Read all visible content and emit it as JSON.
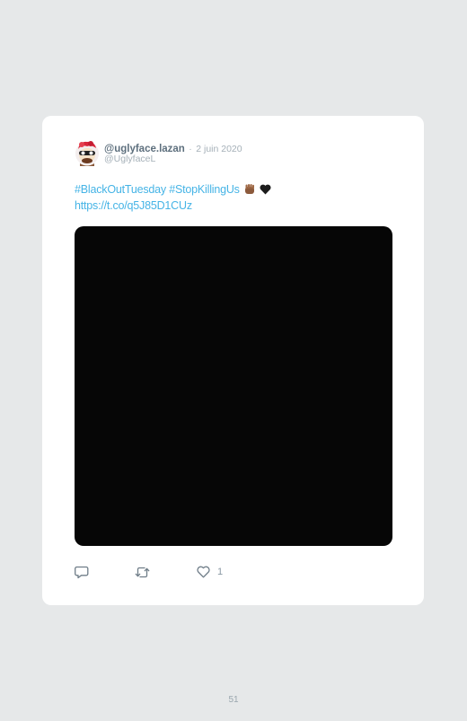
{
  "tweet": {
    "display_name": "@uglyface.lazan",
    "separator": "·",
    "date": "2 juin 2020",
    "handle": "@UglyfaceL",
    "hashtags": [
      "#BlackOutTuesday",
      "#StopKillingUs"
    ],
    "emoji_icons": [
      "brown-raised-fist-icon",
      "black-heart-icon"
    ],
    "link": "https://t.co/q5J85D1CUz",
    "like_count": "1"
  },
  "actions": {
    "reply_icon": "speech-bubble-icon",
    "retweet_icon": "retweet-arrows-icon",
    "like_icon": "heart-icon"
  },
  "colors": {
    "page_background": "#e6e8e9",
    "card_background": "#ffffff",
    "link_blue": "#46b4e6",
    "media_black": "#060606"
  },
  "page": {
    "number": "51"
  }
}
